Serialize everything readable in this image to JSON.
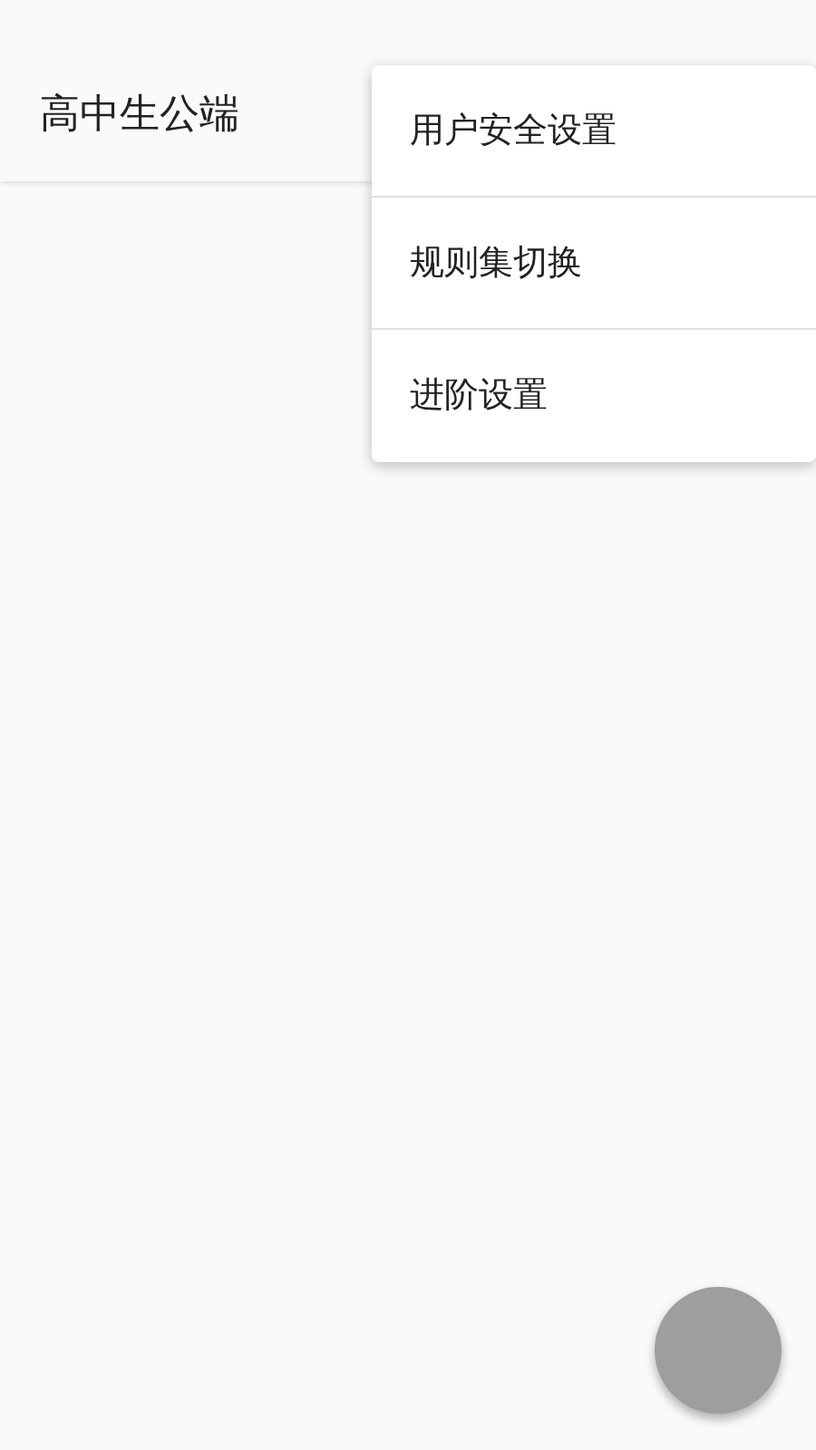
{
  "app_bar": {
    "title": "高中生公端"
  },
  "menu": {
    "items": [
      {
        "label": "用户安全设置"
      },
      {
        "label": "规则集切换"
      },
      {
        "label": "进阶设置"
      }
    ]
  }
}
